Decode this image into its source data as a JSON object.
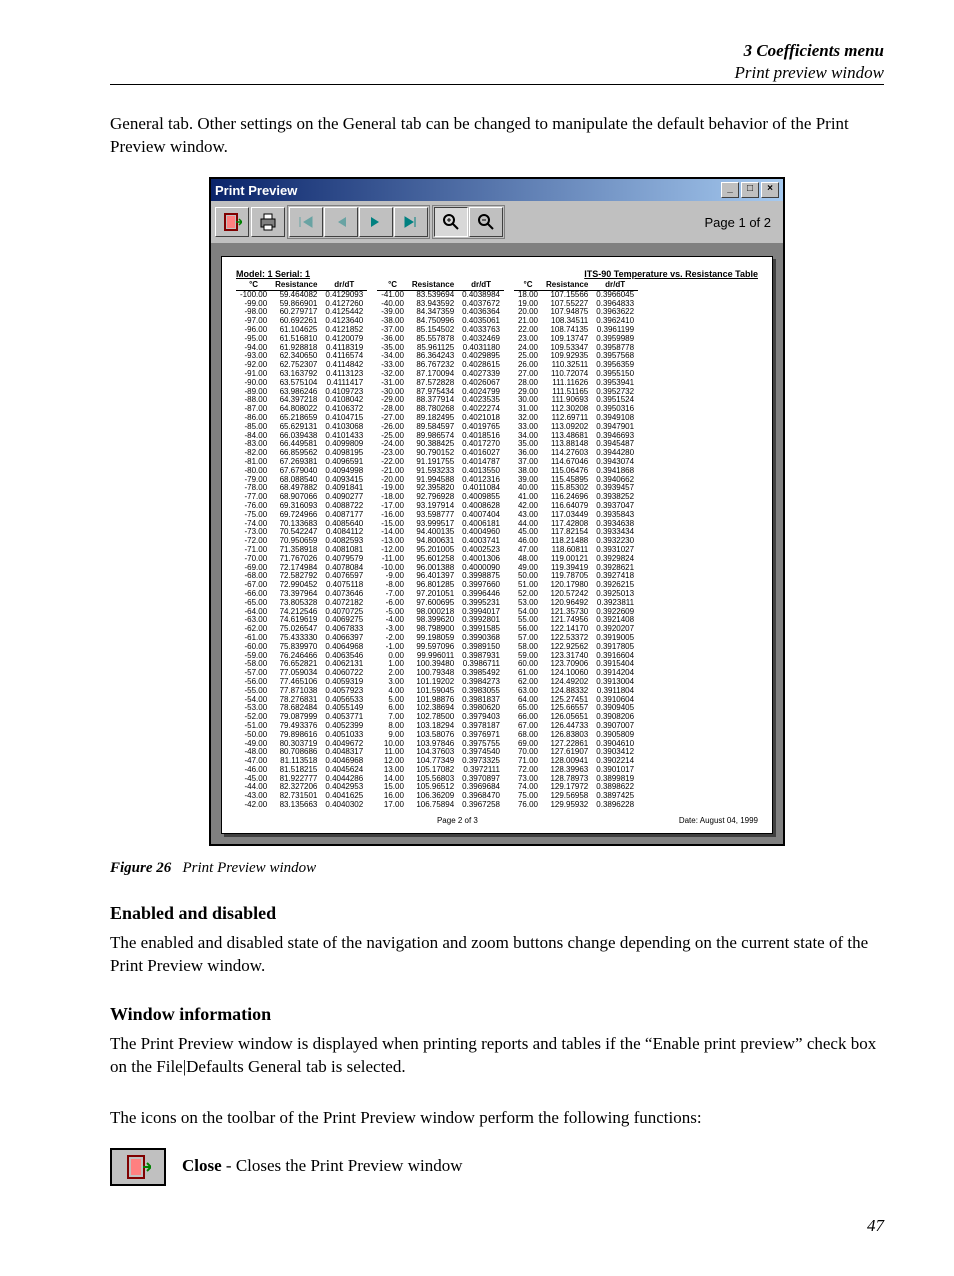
{
  "header": {
    "chapter": "3  Coefficients menu",
    "section": "Print preview window"
  },
  "intro": "General tab. Other settings on the General tab can be changed to manipulate the default behavior of the Print Preview window.",
  "caption": {
    "fig": "Figure 26",
    "text": "Print Preview window"
  },
  "h_enabled": "Enabled and disabled",
  "p_enabled": "The enabled and disabled state of the navigation and zoom buttons change depending on the current state of the Print Preview window.",
  "h_window": "Window information",
  "p_window1": "The Print Preview window is displayed when printing reports and tables if the “Enable print preview” check box on the File|Defaults General tab is selected.",
  "p_window2": "The icons on the toolbar of the Print Preview window perform the following functions:",
  "close_label": "Close",
  "close_text": " - Closes the Print Preview window",
  "page_num": "47",
  "win": {
    "title": "Print Preview",
    "page_of": "Page 1 of 2",
    "sheet_hdr_left": "Model: 1 Serial: 1",
    "sheet_hdr_right": "ITS-90 Temperature vs. Resistance Table",
    "foot_center": "Page 2 of 3",
    "foot_right": "Date: August 04, 1999",
    "col_headers": [
      "°C",
      "Resistance",
      "dr/dT"
    ]
  },
  "chart_data": {
    "type": "table",
    "title": "ITS-90 Temperature vs. Resistance Table",
    "columns": [
      "°C",
      "Resistance",
      "dr/dT"
    ],
    "blocks": [
      [
        [
          "-100.00",
          "59.464082",
          "0.4129093"
        ],
        [
          "-99.00",
          "59.866901",
          "0.4127260"
        ],
        [
          "-98.00",
          "60.279717",
          "0.4125442"
        ],
        [
          "-97.00",
          "60.692261",
          "0.4123640"
        ],
        [
          "-96.00",
          "61.104625",
          "0.4121852"
        ],
        [
          "-95.00",
          "61.516810",
          "0.4120079"
        ],
        [
          "-94.00",
          "61.928818",
          "0.4118319"
        ],
        [
          "-93.00",
          "62.340650",
          "0.4116574"
        ],
        [
          "-92.00",
          "62.752307",
          "0.4114842"
        ],
        [
          "-91.00",
          "63.163792",
          "0.4113123"
        ],
        [
          "-90.00",
          "63.575104",
          "0.4111417"
        ],
        [
          "-89.00",
          "63.986246",
          "0.4109723"
        ],
        [
          "-88.00",
          "64.397218",
          "0.4108042"
        ],
        [
          "-87.00",
          "64.808022",
          "0.4106372"
        ],
        [
          "-86.00",
          "65.218659",
          "0.4104715"
        ],
        [
          "-85.00",
          "65.629131",
          "0.4103068"
        ],
        [
          "-84.00",
          "66.039438",
          "0.4101433"
        ],
        [
          "-83.00",
          "66.449581",
          "0.4099809"
        ],
        [
          "-82.00",
          "66.859562",
          "0.4098195"
        ],
        [
          "-81.00",
          "67.269381",
          "0.4096591"
        ],
        [
          "-80.00",
          "67.679040",
          "0.4094998"
        ],
        [
          "-79.00",
          "68.088540",
          "0.4093415"
        ],
        [
          "-78.00",
          "68.497882",
          "0.4091841"
        ],
        [
          "-77.00",
          "68.907066",
          "0.4090277"
        ],
        [
          "-76.00",
          "69.316093",
          "0.4088722"
        ],
        [
          "-75.00",
          "69.724966",
          "0.4087177"
        ],
        [
          "-74.00",
          "70.133683",
          "0.4085640"
        ],
        [
          "-73.00",
          "70.542247",
          "0.4084112"
        ],
        [
          "-72.00",
          "70.950659",
          "0.4082593"
        ],
        [
          "-71.00",
          "71.358918",
          "0.4081081"
        ],
        [
          "-70.00",
          "71.767026",
          "0.4079579"
        ],
        [
          "-69.00",
          "72.174984",
          "0.4078084"
        ],
        [
          "-68.00",
          "72.582792",
          "0.4076597"
        ],
        [
          "-67.00",
          "72.990452",
          "0.4075118"
        ],
        [
          "-66.00",
          "73.397964",
          "0.4073646"
        ],
        [
          "-65.00",
          "73.805328",
          "0.4072182"
        ],
        [
          "-64.00",
          "74.212546",
          "0.4070725"
        ],
        [
          "-63.00",
          "74.619619",
          "0.4069275"
        ],
        [
          "-62.00",
          "75.026547",
          "0.4067833"
        ],
        [
          "-61.00",
          "75.433330",
          "0.4066397"
        ],
        [
          "-60.00",
          "75.839970",
          "0.4064968"
        ],
        [
          "-59.00",
          "76.246466",
          "0.4063546"
        ],
        [
          "-58.00",
          "76.652821",
          "0.4062131"
        ],
        [
          "-57.00",
          "77.059034",
          "0.4060722"
        ],
        [
          "-56.00",
          "77.465106",
          "0.4059319"
        ],
        [
          "-55.00",
          "77.871038",
          "0.4057923"
        ],
        [
          "-54.00",
          "78.276831",
          "0.4056533"
        ],
        [
          "-53.00",
          "78.682484",
          "0.4055149"
        ],
        [
          "-52.00",
          "79.087999",
          "0.4053771"
        ],
        [
          "-51.00",
          "79.493376",
          "0.4052399"
        ],
        [
          "-50.00",
          "79.898616",
          "0.4051033"
        ],
        [
          "-49.00",
          "80.303719",
          "0.4049672"
        ],
        [
          "-48.00",
          "80.708686",
          "0.4048317"
        ],
        [
          "-47.00",
          "81.113518",
          "0.4046968"
        ],
        [
          "-46.00",
          "81.518215",
          "0.4045624"
        ],
        [
          "-45.00",
          "81.922777",
          "0.4044286"
        ],
        [
          "-44.00",
          "82.327206",
          "0.4042953"
        ],
        [
          "-43.00",
          "82.731501",
          "0.4041625"
        ],
        [
          "-42.00",
          "83.135663",
          "0.4040302"
        ]
      ],
      [
        [
          "-41.00",
          "83.539694",
          "0.4038984"
        ],
        [
          "-40.00",
          "83.943592",
          "0.4037672"
        ],
        [
          "-39.00",
          "84.347359",
          "0.4036364"
        ],
        [
          "-38.00",
          "84.750996",
          "0.4035061"
        ],
        [
          "-37.00",
          "85.154502",
          "0.4033763"
        ],
        [
          "-36.00",
          "85.557878",
          "0.4032469"
        ],
        [
          "-35.00",
          "85.961125",
          "0.4031180"
        ],
        [
          "-34.00",
          "86.364243",
          "0.4029895"
        ],
        [
          "-33.00",
          "86.767232",
          "0.4028615"
        ],
        [
          "-32.00",
          "87.170094",
          "0.4027339"
        ],
        [
          "-31.00",
          "87.572828",
          "0.4026067"
        ],
        [
          "-30.00",
          "87.975434",
          "0.4024799"
        ],
        [
          "-29.00",
          "88.377914",
          "0.4023535"
        ],
        [
          "-28.00",
          "88.780268",
          "0.4022274"
        ],
        [
          "-27.00",
          "89.182495",
          "0.4021018"
        ],
        [
          "-26.00",
          "89.584597",
          "0.4019765"
        ],
        [
          "-25.00",
          "89.986574",
          "0.4018516"
        ],
        [
          "-24.00",
          "90.388425",
          "0.4017270"
        ],
        [
          "-23.00",
          "90.790152",
          "0.4016027"
        ],
        [
          "-22.00",
          "91.191755",
          "0.4014787"
        ],
        [
          "-21.00",
          "91.593233",
          "0.4013550"
        ],
        [
          "-20.00",
          "91.994588",
          "0.4012316"
        ],
        [
          "-19.00",
          "92.395820",
          "0.4011084"
        ],
        [
          "-18.00",
          "92.796928",
          "0.4009855"
        ],
        [
          "-17.00",
          "93.197914",
          "0.4008628"
        ],
        [
          "-16.00",
          "93.598777",
          "0.4007404"
        ],
        [
          "-15.00",
          "93.999517",
          "0.4006181"
        ],
        [
          "-14.00",
          "94.400135",
          "0.4004960"
        ],
        [
          "-13.00",
          "94.800631",
          "0.4003741"
        ],
        [
          "-12.00",
          "95.201005",
          "0.4002523"
        ],
        [
          "-11.00",
          "95.601258",
          "0.4001306"
        ],
        [
          "-10.00",
          "96.001388",
          "0.4000090"
        ],
        [
          "-9.00",
          "96.401397",
          "0.3998875"
        ],
        [
          "-8.00",
          "96.801285",
          "0.3997660"
        ],
        [
          "-7.00",
          "97.201051",
          "0.3996446"
        ],
        [
          "-6.00",
          "97.600695",
          "0.3995231"
        ],
        [
          "-5.00",
          "98.000218",
          "0.3994017"
        ],
        [
          "-4.00",
          "98.399620",
          "0.3992801"
        ],
        [
          "-3.00",
          "98.798900",
          "0.3991585"
        ],
        [
          "-2.00",
          "99.198059",
          "0.3990368"
        ],
        [
          "-1.00",
          "99.597096",
          "0.3989150"
        ],
        [
          "0.00",
          "99.996011",
          "0.3987931"
        ],
        [
          "1.00",
          "100.39480",
          "0.3986711"
        ],
        [
          "2.00",
          "100.79348",
          "0.3985492"
        ],
        [
          "3.00",
          "101.19202",
          "0.3984273"
        ],
        [
          "4.00",
          "101.59045",
          "0.3983055"
        ],
        [
          "5.00",
          "101.98876",
          "0.3981837"
        ],
        [
          "6.00",
          "102.38694",
          "0.3980620"
        ],
        [
          "7.00",
          "102.78500",
          "0.3979403"
        ],
        [
          "8.00",
          "103.18294",
          "0.3978187"
        ],
        [
          "9.00",
          "103.58076",
          "0.3976971"
        ],
        [
          "10.00",
          "103.97846",
          "0.3975755"
        ],
        [
          "11.00",
          "104.37603",
          "0.3974540"
        ],
        [
          "12.00",
          "104.77349",
          "0.3973325"
        ],
        [
          "13.00",
          "105.17082",
          "0.3972111"
        ],
        [
          "14.00",
          "105.56803",
          "0.3970897"
        ],
        [
          "15.00",
          "105.96512",
          "0.3969684"
        ],
        [
          "16.00",
          "106.36209",
          "0.3968470"
        ],
        [
          "17.00",
          "106.75894",
          "0.3967258"
        ]
      ],
      [
        [
          "18.00",
          "107.15566",
          "0.3966045"
        ],
        [
          "19.00",
          "107.55227",
          "0.3964833"
        ],
        [
          "20.00",
          "107.94875",
          "0.3963622"
        ],
        [
          "21.00",
          "108.34511",
          "0.3962410"
        ],
        [
          "22.00",
          "108.74135",
          "0.3961199"
        ],
        [
          "23.00",
          "109.13747",
          "0.3959989"
        ],
        [
          "24.00",
          "109.53347",
          "0.3958778"
        ],
        [
          "25.00",
          "109.92935",
          "0.3957568"
        ],
        [
          "26.00",
          "110.32511",
          "0.3956359"
        ],
        [
          "27.00",
          "110.72074",
          "0.3955150"
        ],
        [
          "28.00",
          "111.11626",
          "0.3953941"
        ],
        [
          "29.00",
          "111.51165",
          "0.3952732"
        ],
        [
          "30.00",
          "111.90693",
          "0.3951524"
        ],
        [
          "31.00",
          "112.30208",
          "0.3950316"
        ],
        [
          "32.00",
          "112.69711",
          "0.3949108"
        ],
        [
          "33.00",
          "113.09202",
          "0.3947901"
        ],
        [
          "34.00",
          "113.48681",
          "0.3946693"
        ],
        [
          "35.00",
          "113.88148",
          "0.3945487"
        ],
        [
          "36.00",
          "114.27603",
          "0.3944280"
        ],
        [
          "37.00",
          "114.67046",
          "0.3943074"
        ],
        [
          "38.00",
          "115.06476",
          "0.3941868"
        ],
        [
          "39.00",
          "115.45895",
          "0.3940662"
        ],
        [
          "40.00",
          "115.85302",
          "0.3939457"
        ],
        [
          "41.00",
          "116.24696",
          "0.3938252"
        ],
        [
          "42.00",
          "116.64079",
          "0.3937047"
        ],
        [
          "43.00",
          "117.03449",
          "0.3935843"
        ],
        [
          "44.00",
          "117.42808",
          "0.3934638"
        ],
        [
          "45.00",
          "117.82154",
          "0.3933434"
        ],
        [
          "46.00",
          "118.21488",
          "0.3932230"
        ],
        [
          "47.00",
          "118.60811",
          "0.3931027"
        ],
        [
          "48.00",
          "119.00121",
          "0.3929824"
        ],
        [
          "49.00",
          "119.39419",
          "0.3928621"
        ],
        [
          "50.00",
          "119.78705",
          "0.3927418"
        ],
        [
          "51.00",
          "120.17980",
          "0.3926215"
        ],
        [
          "52.00",
          "120.57242",
          "0.3925013"
        ],
        [
          "53.00",
          "120.96492",
          "0.3923811"
        ],
        [
          "54.00",
          "121.35730",
          "0.3922609"
        ],
        [
          "55.00",
          "121.74956",
          "0.3921408"
        ],
        [
          "56.00",
          "122.14170",
          "0.3920207"
        ],
        [
          "57.00",
          "122.53372",
          "0.3919005"
        ],
        [
          "58.00",
          "122.92562",
          "0.3917805"
        ],
        [
          "59.00",
          "123.31740",
          "0.3916604"
        ],
        [
          "60.00",
          "123.70906",
          "0.3915404"
        ],
        [
          "61.00",
          "124.10060",
          "0.3914204"
        ],
        [
          "62.00",
          "124.49202",
          "0.3913004"
        ],
        [
          "63.00",
          "124.88332",
          "0.3911804"
        ],
        [
          "64.00",
          "125.27451",
          "0.3910604"
        ],
        [
          "65.00",
          "125.66557",
          "0.3909405"
        ],
        [
          "66.00",
          "126.05651",
          "0.3908206"
        ],
        [
          "67.00",
          "126.44733",
          "0.3907007"
        ],
        [
          "68.00",
          "126.83803",
          "0.3905809"
        ],
        [
          "69.00",
          "127.22861",
          "0.3904610"
        ],
        [
          "70.00",
          "127.61907",
          "0.3903412"
        ],
        [
          "71.00",
          "128.00941",
          "0.3902214"
        ],
        [
          "72.00",
          "128.39963",
          "0.3901017"
        ],
        [
          "73.00",
          "128.78973",
          "0.3899819"
        ],
        [
          "74.00",
          "129.17972",
          "0.3898622"
        ],
        [
          "75.00",
          "129.56958",
          "0.3897425"
        ],
        [
          "76.00",
          "129.95932",
          "0.3896228"
        ]
      ]
    ]
  }
}
